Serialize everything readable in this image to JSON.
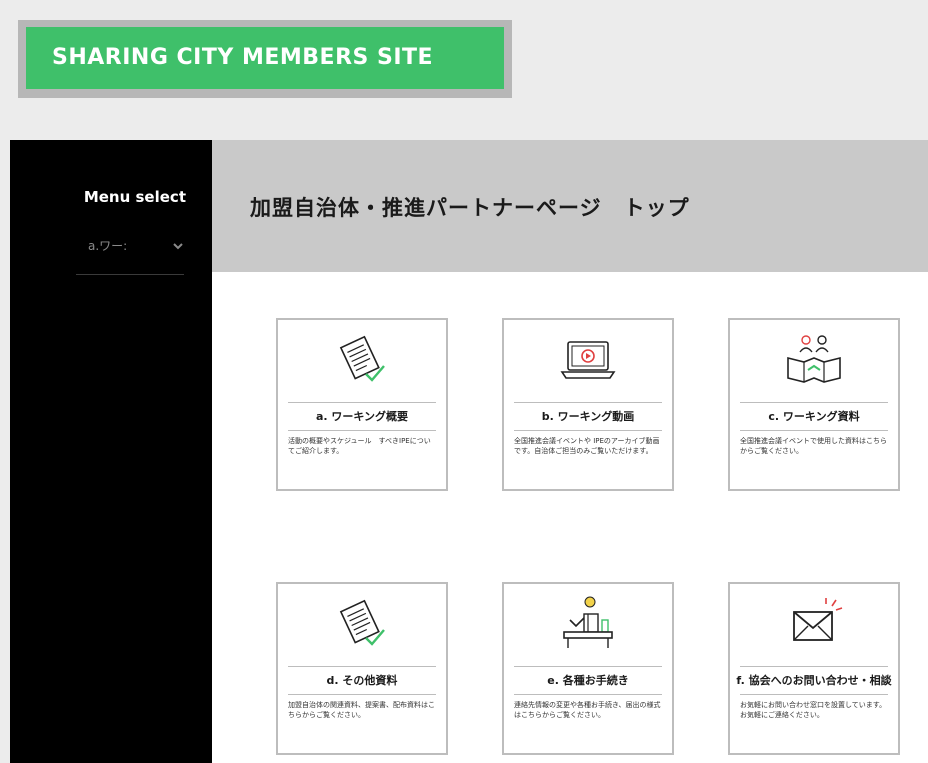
{
  "site": {
    "logo_text": "SHARING CITY MEMBERS SITE"
  },
  "sidebar": {
    "menu_title": "Menu select",
    "select_value": "a.ワー:"
  },
  "page": {
    "title": "加盟自治体・推進パートナーページ　トップ"
  },
  "cards": [
    {
      "label": "a. ワーキング概要",
      "desc": "活動の概要やスケジュール　すべきIPEについてご紹介します。",
      "icon": "document-icon"
    },
    {
      "label": "b. ワーキング動画",
      "desc": "全国推進会議イベントや IPEのアーカイブ動画です。自治体ご担当のみご覧いただけます。",
      "icon": "laptop-video-icon"
    },
    {
      "label": "c. ワーキング資料",
      "desc": "全国推進会議イベントで使用した資料はこちらからご覧ください。",
      "icon": "people-map-icon"
    },
    {
      "label": "d. その他資料",
      "desc": "加盟自治体の関連資料、提案書、配布資料はこちらからご覧ください。",
      "icon": "document-icon"
    },
    {
      "label": "e. 各種お手続き",
      "desc": "連絡先情報の変更や各種お手続き、届出の様式はこちらからご覧ください。",
      "icon": "desk-person-icon"
    },
    {
      "label": "f. 協会へのお問い合わせ・相談",
      "desc": "お気軽にお問い合わせ窓口を設置しています。お気軽にご連絡ください。",
      "icon": "envelope-icon"
    }
  ],
  "colors": {
    "brand_green": "#3fc06a",
    "sidebar_bg": "#000000",
    "title_bar_bg": "#c9c9c9",
    "icon_red": "#e04040",
    "icon_green": "#3fc06a"
  }
}
